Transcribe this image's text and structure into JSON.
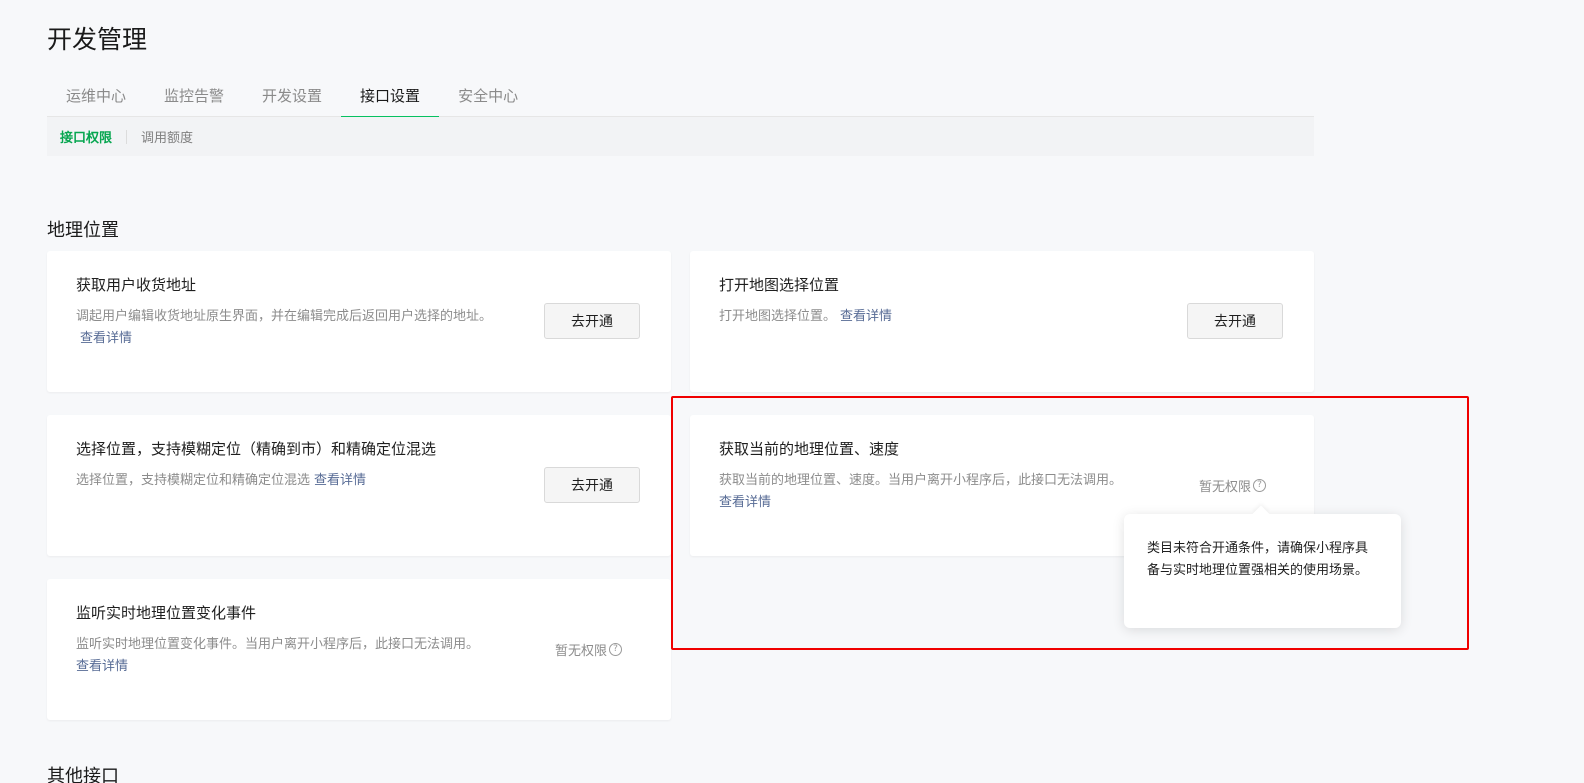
{
  "page_title": "开发管理",
  "tabs": [
    {
      "label": "运维中心"
    },
    {
      "label": "监控告警"
    },
    {
      "label": "开发设置"
    },
    {
      "label": "接口设置"
    },
    {
      "label": "安全中心"
    }
  ],
  "active_tab": "接口设置",
  "subnav": [
    {
      "label": "接口权限"
    },
    {
      "label": "调用额度"
    }
  ],
  "active_subnav": "接口权限",
  "sections": [
    {
      "title": "地理位置"
    },
    {
      "title": "其他接口"
    }
  ],
  "cards": [
    {
      "title": "获取用户收货地址",
      "desc": "调起用户编辑收货地址原生界面，并在编辑完成后返回用户选择的地址。",
      "link": "查看详情",
      "action": "去开通"
    },
    {
      "title": "打开地图选择位置",
      "desc": "打开地图选择位置。",
      "link": "查看详情",
      "action": "去开通"
    },
    {
      "title": "选择位置，支持模糊定位（精确到市）和精确定位混选",
      "desc": "选择位置，支持模糊定位和精确定位混选",
      "link": "查看详情",
      "action": "去开通"
    },
    {
      "title": "获取当前的地理位置、速度",
      "desc": "获取当前的地理位置、速度。当用户离开小程序后，此接口无法调用。",
      "link": "查看详情",
      "status": "暂无权限"
    },
    {
      "title": "监听实时地理位置变化事件",
      "desc": "监听实时地理位置变化事件。当用户离开小程序后，此接口无法调用。",
      "link": "查看详情",
      "status": "暂无权限"
    }
  ],
  "tooltip": {
    "text": "类目未符合开通条件，请确保小程序具备与实时地理位置强相关的使用场景。"
  },
  "colors": {
    "accent": "#07c160",
    "link": "#576b95",
    "highlight": "#f00000"
  },
  "icons": {
    "help": "question-circle-icon"
  }
}
